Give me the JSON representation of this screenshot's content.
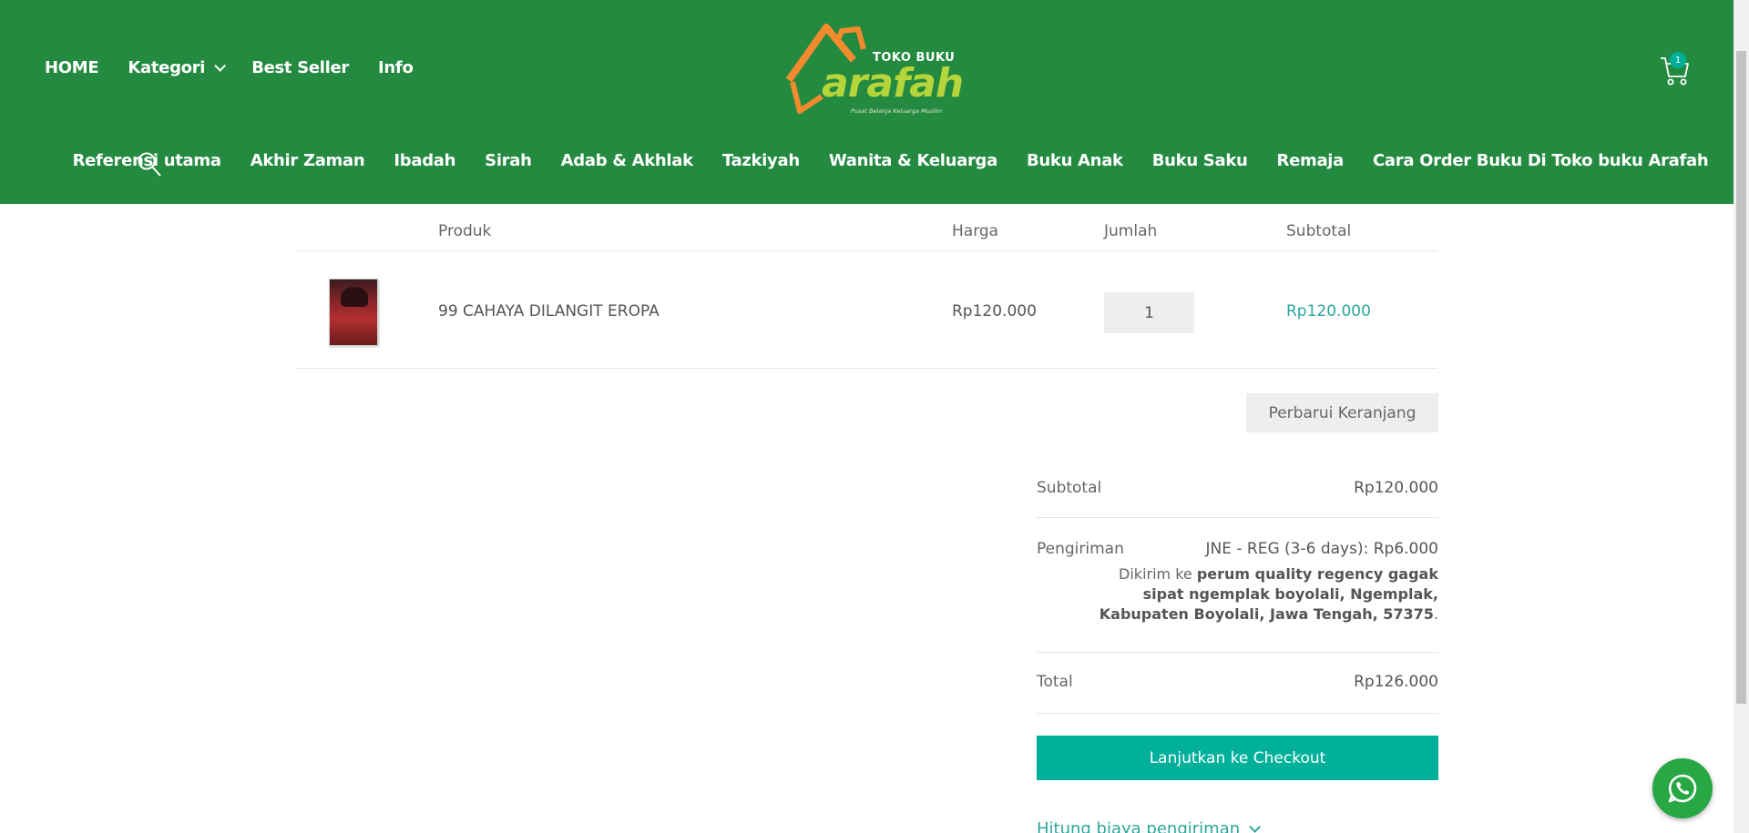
{
  "header": {
    "topnav": [
      {
        "label": "HOME"
      },
      {
        "label": "Kategori"
      },
      {
        "label": "Best Seller"
      },
      {
        "label": "Info"
      }
    ],
    "logo": {
      "top_text": "TOKO BUKU",
      "word": "arafah",
      "tagline": "Pusat Belanja Keluarga Muslim"
    },
    "cart_count": "1",
    "categories": [
      {
        "label": "Referensi utama"
      },
      {
        "label": "Akhir Zaman"
      },
      {
        "label": "Ibadah"
      },
      {
        "label": "Sirah"
      },
      {
        "label": "Adab & Akhlak"
      },
      {
        "label": "Tazkiyah"
      },
      {
        "label": "Wanita & Keluarga"
      },
      {
        "label": "Buku Anak"
      },
      {
        "label": "Buku Saku"
      },
      {
        "label": "Remaja"
      },
      {
        "label": "Cara Order Buku Di Toko buku Arafah"
      }
    ]
  },
  "cart_table": {
    "headers": {
      "product": "Produk",
      "price": "Harga",
      "qty": "Jumlah",
      "subtotal": "Subtotal"
    },
    "items": [
      {
        "name": "99 CAHAYA DILANGIT EROPA",
        "price": "Rp120.000",
        "qty": "1",
        "subtotal": "Rp120.000"
      }
    ],
    "update_label": "Perbarui Keranjang"
  },
  "totals": {
    "subtotal_label": "Subtotal",
    "subtotal_value": "Rp120.000",
    "shipping_label": "Pengiriman",
    "shipping_value": "JNE - REG (3-6 days): Rp6.000",
    "ship_to_prefix": "Dikirim ke",
    "ship_to_address": "perum quality regency gagak sipat ngemplak boyolali, Ngemplak, Kabupaten Boyolali, Jawa Tengah, 57375",
    "ship_to_suffix": ".",
    "total_label": "Total",
    "total_value": "Rp126.000",
    "checkout_label": "Lanjutkan ke Checkout",
    "calc_shipping_label": "Hitung biaya pengiriman"
  },
  "colors": {
    "header_green": "#238a40",
    "accent_teal": "#00b09b",
    "logo_orange": "#f28a2e",
    "logo_lime": "#b6d53a",
    "whatsapp_green": "#28a745"
  }
}
